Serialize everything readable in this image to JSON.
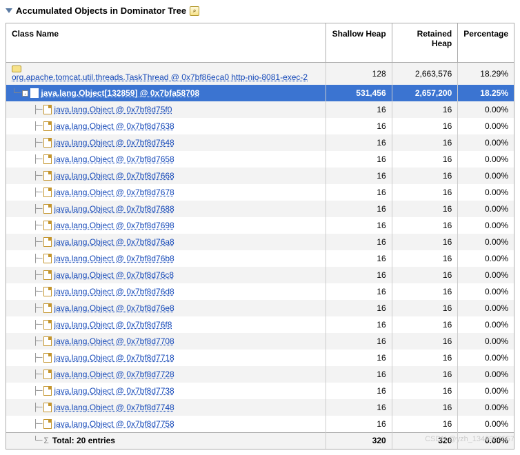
{
  "header": {
    "title": "Accumulated Objects in Dominator Tree"
  },
  "columns": {
    "name": "Class Name",
    "shallow": "Shallow Heap",
    "retained": "Retained Heap",
    "percent": "Percentage"
  },
  "root": {
    "label": "org.apache.tomcat.util.threads.TaskThread @ 0x7bf86eca0 http-nio-8081-exec-2",
    "shallow": "128",
    "retained": "2,663,576",
    "percent": "18.29%"
  },
  "selected": {
    "label": "java.lang.Object[132859] @ 0x7bfa58708",
    "shallow": "531,456",
    "retained": "2,657,200",
    "percent": "18.25%"
  },
  "children": [
    {
      "label": "java.lang.Object @ 0x7bf8d75f0",
      "shallow": "16",
      "retained": "16",
      "percent": "0.00%"
    },
    {
      "label": "java.lang.Object @ 0x7bf8d7638",
      "shallow": "16",
      "retained": "16",
      "percent": "0.00%"
    },
    {
      "label": "java.lang.Object @ 0x7bf8d7648",
      "shallow": "16",
      "retained": "16",
      "percent": "0.00%"
    },
    {
      "label": "java.lang.Object @ 0x7bf8d7658",
      "shallow": "16",
      "retained": "16",
      "percent": "0.00%"
    },
    {
      "label": "java.lang.Object @ 0x7bf8d7668",
      "shallow": "16",
      "retained": "16",
      "percent": "0.00%"
    },
    {
      "label": "java.lang.Object @ 0x7bf8d7678",
      "shallow": "16",
      "retained": "16",
      "percent": "0.00%"
    },
    {
      "label": "java.lang.Object @ 0x7bf8d7688",
      "shallow": "16",
      "retained": "16",
      "percent": "0.00%"
    },
    {
      "label": "java.lang.Object @ 0x7bf8d7698",
      "shallow": "16",
      "retained": "16",
      "percent": "0.00%"
    },
    {
      "label": "java.lang.Object @ 0x7bf8d76a8",
      "shallow": "16",
      "retained": "16",
      "percent": "0.00%"
    },
    {
      "label": "java.lang.Object @ 0x7bf8d76b8",
      "shallow": "16",
      "retained": "16",
      "percent": "0.00%"
    },
    {
      "label": "java.lang.Object @ 0x7bf8d76c8",
      "shallow": "16",
      "retained": "16",
      "percent": "0.00%"
    },
    {
      "label": "java.lang.Object @ 0x7bf8d76d8",
      "shallow": "16",
      "retained": "16",
      "percent": "0.00%"
    },
    {
      "label": "java.lang.Object @ 0x7bf8d76e8",
      "shallow": "16",
      "retained": "16",
      "percent": "0.00%"
    },
    {
      "label": "java.lang.Object @ 0x7bf8d76f8",
      "shallow": "16",
      "retained": "16",
      "percent": "0.00%"
    },
    {
      "label": "java.lang.Object @ 0x7bf8d7708",
      "shallow": "16",
      "retained": "16",
      "percent": "0.00%"
    },
    {
      "label": "java.lang.Object @ 0x7bf8d7718",
      "shallow": "16",
      "retained": "16",
      "percent": "0.00%"
    },
    {
      "label": "java.lang.Object @ 0x7bf8d7728",
      "shallow": "16",
      "retained": "16",
      "percent": "0.00%"
    },
    {
      "label": "java.lang.Object @ 0x7bf8d7738",
      "shallow": "16",
      "retained": "16",
      "percent": "0.00%"
    },
    {
      "label": "java.lang.Object @ 0x7bf8d7748",
      "shallow": "16",
      "retained": "16",
      "percent": "0.00%"
    },
    {
      "label": "java.lang.Object @ 0x7bf8d7758",
      "shallow": "16",
      "retained": "16",
      "percent": "0.00%"
    }
  ],
  "total": {
    "label": "Total: 20 entries",
    "shallow": "320",
    "retained": "320",
    "percent": "0.00%"
  },
  "watermark": "CSDN @yzh_1346983557"
}
